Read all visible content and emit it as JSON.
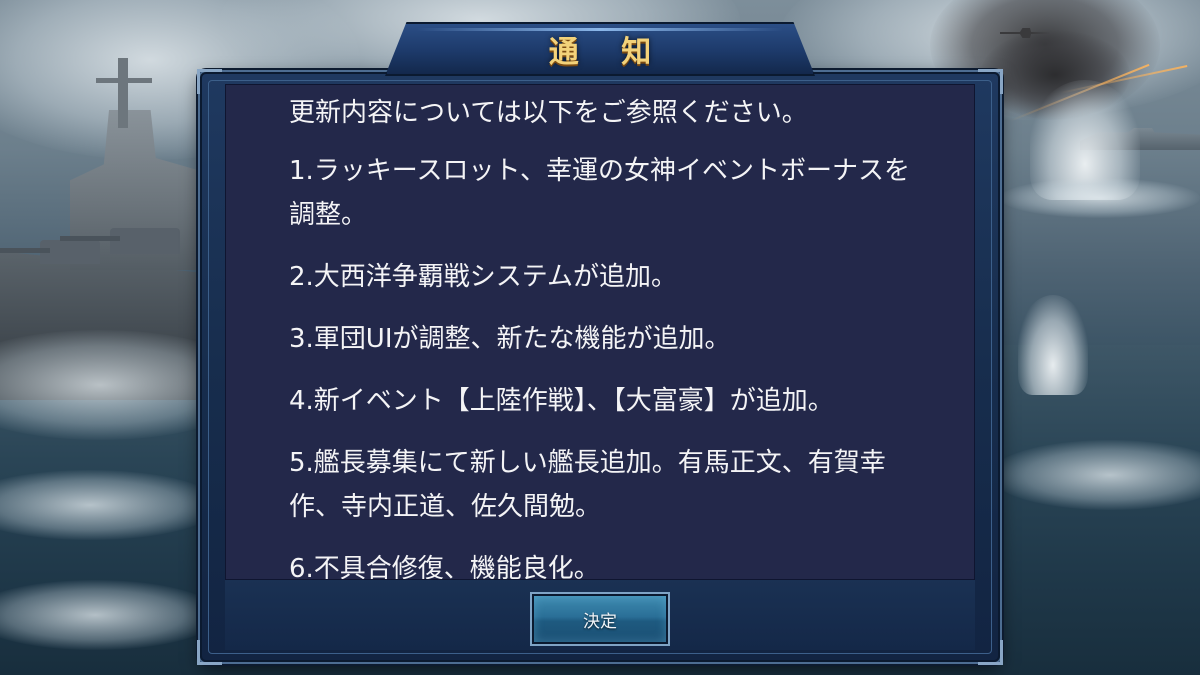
{
  "dialog": {
    "title": "通 知",
    "lines": [
      "更新内容については以下をご参照ください。",
      "1.ラッキースロット、幸運の女神イベントボーナスを調整。",
      "2.大西洋争覇戦システムが追加。",
      "3.軍団UIが調整、新たな機能が追加。",
      "4.新イベント【上陸作戦】、【大富豪】が追加。",
      "5.艦長募集にて新しい艦長追加。有馬正文、有賀幸作、寺内正道、佐久間勉。",
      "6.不具合修復、機能良化。"
    ],
    "confirm_label": "決定"
  },
  "colors": {
    "title_gold": "#f3d27a",
    "panel_bg": "#23284a",
    "frame_blue": "#1d3a6a",
    "button_teal": "#2a6f97"
  }
}
